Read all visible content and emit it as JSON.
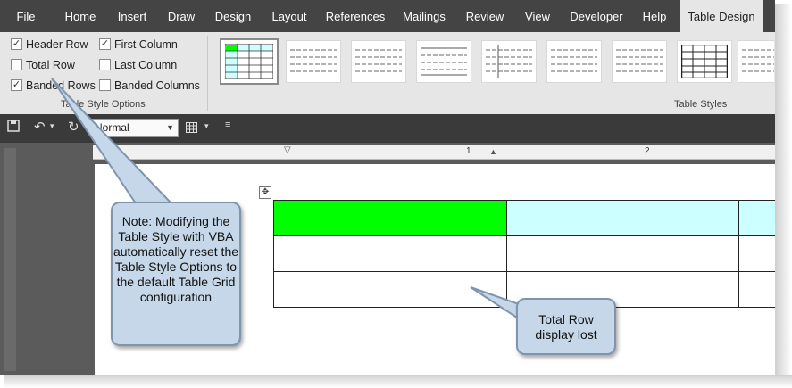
{
  "ribbon": {
    "tabs": [
      {
        "label": "File",
        "active": false
      },
      {
        "label": "Home",
        "active": false
      },
      {
        "label": "Insert",
        "active": false
      },
      {
        "label": "Draw",
        "active": false
      },
      {
        "label": "Design",
        "active": false
      },
      {
        "label": "Layout",
        "active": false
      },
      {
        "label": "References",
        "active": false
      },
      {
        "label": "Mailings",
        "active": false
      },
      {
        "label": "Review",
        "active": false
      },
      {
        "label": "View",
        "active": false
      },
      {
        "label": "Developer",
        "active": false
      },
      {
        "label": "Help",
        "active": false
      },
      {
        "label": "Table Design",
        "active": true
      }
    ],
    "style_options": {
      "group_label": "Table Style Options",
      "header_row": {
        "label": "Header Row",
        "checked": true
      },
      "first_column": {
        "label": "First Column",
        "checked": true
      },
      "total_row": {
        "label": "Total Row",
        "checked": false
      },
      "last_column": {
        "label": "Last Column",
        "checked": false
      },
      "banded_rows": {
        "label": "Banded Rows",
        "checked": true
      },
      "banded_columns": {
        "label": "Banded Columns",
        "checked": false
      }
    },
    "table_styles": {
      "group_label": "Table Styles"
    }
  },
  "qat": {
    "style_value": "Normal",
    "icons": [
      "save-icon",
      "undo-icon",
      "redo-icon",
      "table-icon",
      "customize-icon"
    ]
  },
  "ruler": {
    "numbers": [
      "1",
      "2"
    ]
  },
  "callouts": {
    "note": "Note: Modifying the Table Style with VBA automatically reset the Table Style Options to the default Table Grid configuration",
    "total_row": "Total Row display lost"
  },
  "colors": {
    "header_first_cell": "#00ff00",
    "header_cell": "#ccffff",
    "callout_fill": "#c5d7e8",
    "ribbon_tab_bg": "#444444"
  }
}
